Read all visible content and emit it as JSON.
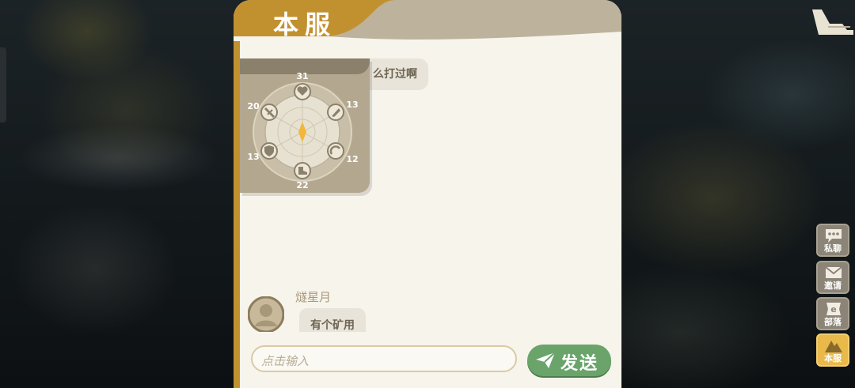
{
  "panel": {
    "tab_title": "本服"
  },
  "chat": {
    "partial_message": "么打过啊",
    "radar_stats": {
      "top": "31",
      "upper_right": "13",
      "lower_right": "12",
      "bottom": "22",
      "lower_left": "13",
      "upper_left": "20"
    },
    "message2": {
      "sender": "燧星月",
      "text": "有个矿用"
    }
  },
  "input": {
    "placeholder": "点击输入"
  },
  "send_button": {
    "label": "发送"
  },
  "side_menu": {
    "items": [
      {
        "label": "私聊",
        "icon": "chat-bubble-icon"
      },
      {
        "label": "邀请",
        "icon": "envelope-icon"
      },
      {
        "label": "部落",
        "icon": "tribe-flag-icon"
      },
      {
        "label": "本服",
        "icon": "mountain-icon"
      }
    ]
  },
  "colors": {
    "accent_gold": "#c2912f",
    "panel_bg": "#f7f4ec",
    "send_green": "#6aa46b",
    "active_tab": "#e9b94a"
  }
}
